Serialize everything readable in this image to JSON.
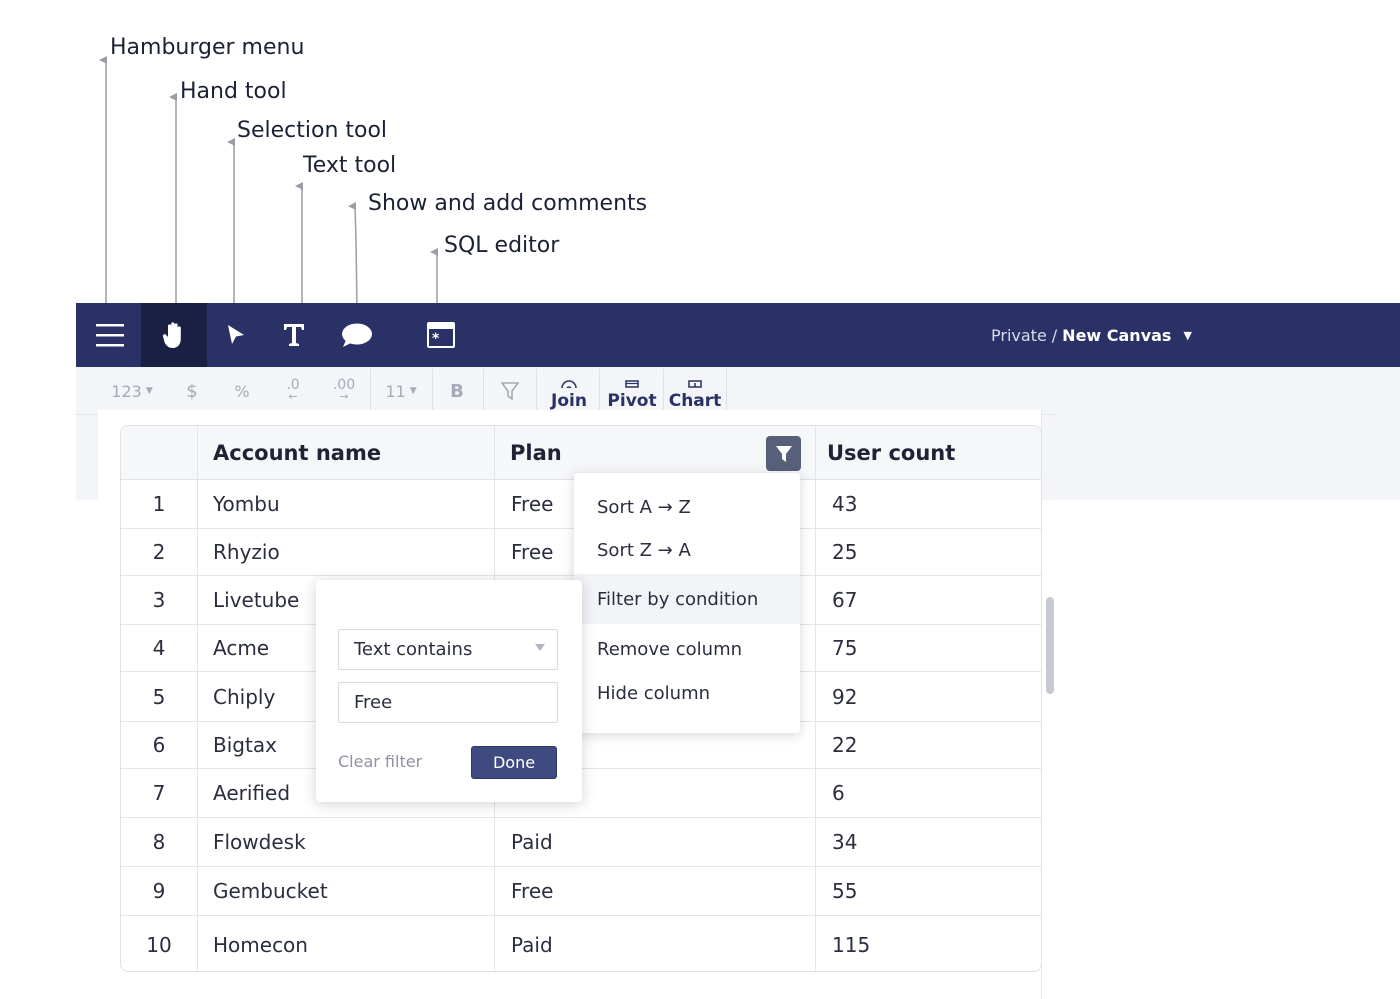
{
  "annotations": {
    "hamburger": "Hamburger menu",
    "hand": "Hand tool",
    "selection": "Selection tool",
    "text": "Text tool",
    "comments": "Show and add comments",
    "sql": "SQL editor"
  },
  "navbar": {
    "workspace": "Private",
    "separator": "/",
    "canvas_name": "New Canvas",
    "caret": "▼",
    "icons": [
      "hamburger-icon",
      "hand-icon",
      "cursor-icon",
      "text-icon",
      "comment-icon",
      "sql-editor-icon"
    ],
    "colors": {
      "background": "#2a3166",
      "active": "#1a1f44"
    }
  },
  "toolbar": {
    "number_format": "123",
    "currency": "$",
    "percent": "%",
    "decrease_decimals": ".0",
    "increase_decimals": ".00",
    "font_size": "11",
    "bold": "B",
    "join": "Join",
    "pivot": "Pivot",
    "chart": "Chart"
  },
  "table": {
    "headers": {
      "account": "Account name",
      "plan": "Plan",
      "users": "User count"
    },
    "rows": [
      {
        "n": "1",
        "account": "Yombu",
        "plan": "Free",
        "users": "43"
      },
      {
        "n": "2",
        "account": "Rhyzio",
        "plan": "Free",
        "users": "25"
      },
      {
        "n": "3",
        "account": "Livetube",
        "plan": "",
        "users": "67"
      },
      {
        "n": "4",
        "account": "Acme",
        "plan": "",
        "users": "75"
      },
      {
        "n": "5",
        "account": "Chiply",
        "plan": "",
        "users": "92"
      },
      {
        "n": "6",
        "account": "Bigtax",
        "plan": "",
        "users": "22"
      },
      {
        "n": "7",
        "account": "Aerified",
        "plan": "",
        "users": "6"
      },
      {
        "n": "8",
        "account": "Flowdesk",
        "plan": "Paid",
        "users": "34"
      },
      {
        "n": "9",
        "account": "Gembucket",
        "plan": "Free",
        "users": "55"
      },
      {
        "n": "10",
        "account": "Homecon",
        "plan": "Paid",
        "users": "115"
      }
    ]
  },
  "column_menu": {
    "sort_az": "Sort A → Z",
    "sort_za": "Sort Z → A",
    "filter_condition": "Filter by condition",
    "remove_column": "Remove column",
    "hide_column": "Hide column"
  },
  "filter_popover": {
    "condition": "Text contains",
    "value": "Free",
    "clear": "Clear filter",
    "done": "Done"
  }
}
